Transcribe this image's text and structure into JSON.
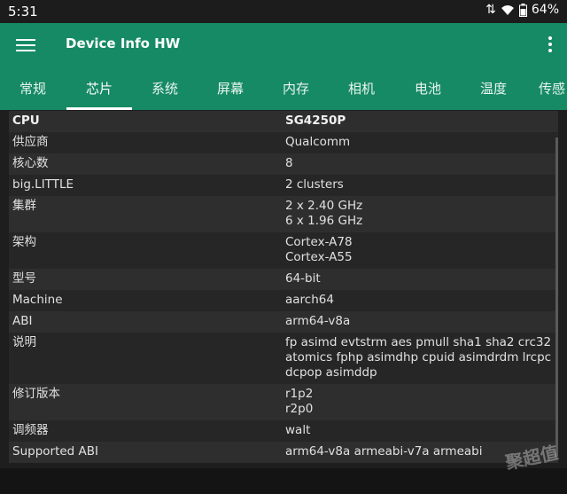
{
  "status": {
    "time": "5:31",
    "battery": "64%"
  },
  "app": {
    "title": "Device Info HW"
  },
  "tabs": [
    {
      "label": "常规"
    },
    {
      "label": "芯片"
    },
    {
      "label": "系统"
    },
    {
      "label": "屏幕"
    },
    {
      "label": "内存"
    },
    {
      "label": "相机"
    },
    {
      "label": "电池"
    },
    {
      "label": "温度"
    },
    {
      "label": "传感"
    }
  ],
  "rows": [
    {
      "key": "CPU",
      "value": "SG4250P"
    },
    {
      "key": "供应商",
      "value": "Qualcomm"
    },
    {
      "key": "核心数",
      "value": "8"
    },
    {
      "key": "big.LITTLE",
      "value": "2 clusters"
    },
    {
      "key": "集群",
      "value": "2 x 2.40 GHz\n6 x 1.96 GHz"
    },
    {
      "key": "架构",
      "value": "Cortex-A78\nCortex-A55"
    },
    {
      "key": "型号",
      "value": "64-bit"
    },
    {
      "key": "Machine",
      "value": "aarch64"
    },
    {
      "key": "ABI",
      "value": "arm64-v8a"
    },
    {
      "key": "说明",
      "value": "fp asimd evtstrm aes pmull sha1 sha2 crc32\natomics fphp asimdhp cpuid asimdrdm lrcpc\ndcpop asimddp"
    },
    {
      "key": "修订版本",
      "value": "r1p2\nr2p0"
    },
    {
      "key": "调频器",
      "value": "walt"
    },
    {
      "key": "Supported ABI",
      "value": "arm64-v8a armeabi-v7a armeabi"
    }
  ],
  "watermark": "聚超值"
}
